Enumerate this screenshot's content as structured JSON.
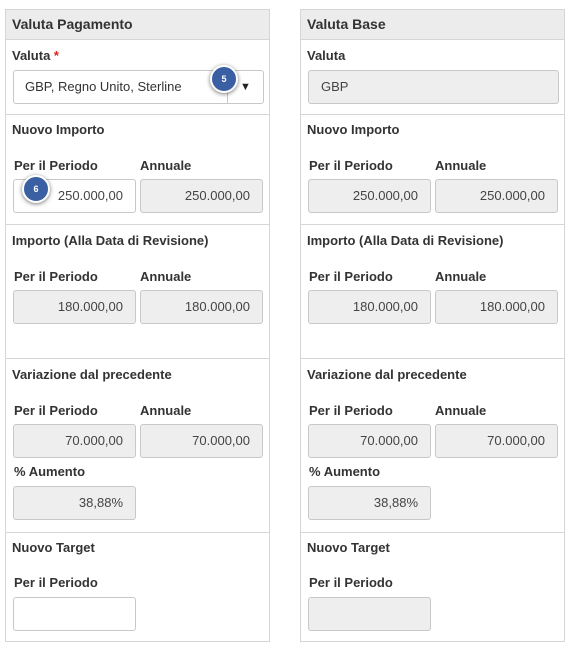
{
  "left": {
    "header": "Valuta Pagamento",
    "currency_label": "Valuta",
    "required_mark": "*",
    "currency_value": "GBP, Regno Unito, Sterline",
    "nuovo_importo": {
      "label": "Nuovo Importo",
      "periodo_label": "Per il Periodo",
      "annuale_label": "Annuale",
      "periodo_value": "250.000,00",
      "annuale_value": "250.000,00"
    },
    "importo_revisione": {
      "label": "Importo (Alla Data di Revisione)",
      "periodo_label": "Per il Periodo",
      "annuale_label": "Annuale",
      "periodo_value": "180.000,00",
      "annuale_value": "180.000,00"
    },
    "variazione": {
      "label": "Variazione dal precedente",
      "periodo_label": "Per il Periodo",
      "annuale_label": "Annuale",
      "periodo_value": "70.000,00",
      "annuale_value": "70.000,00",
      "aumento_label": "% Aumento",
      "aumento_value": "38,88%"
    },
    "nuovo_target": {
      "label": "Nuovo Target",
      "periodo_label": "Per il Periodo",
      "periodo_value": ""
    }
  },
  "right": {
    "header": "Valuta Base",
    "currency_label": "Valuta",
    "currency_value": "GBP",
    "nuovo_importo": {
      "label": "Nuovo Importo",
      "periodo_label": "Per il Periodo",
      "annuale_label": "Annuale",
      "periodo_value": "250.000,00",
      "annuale_value": "250.000,00"
    },
    "importo_revisione": {
      "label": "Importo (Alla Data di Revisione)",
      "periodo_label": "Per il Periodo",
      "annuale_label": "Annuale",
      "periodo_value": "180.000,00",
      "annuale_value": "180.000,00"
    },
    "variazione": {
      "label": "Variazione dal precedente",
      "periodo_label": "Per il Periodo",
      "annuale_label": "Annuale",
      "periodo_value": "70.000,00",
      "annuale_value": "70.000,00",
      "aumento_label": "% Aumento",
      "aumento_value": "38,88%"
    },
    "nuovo_target": {
      "label": "Nuovo Target",
      "periodo_label": "Per il Periodo",
      "periodo_value": ""
    }
  },
  "badges": {
    "step5": "5",
    "step6": "6"
  },
  "icons": {
    "dropdown": "▼"
  },
  "colors": {
    "required": "#d9251d",
    "badge": "#3a5fa3",
    "readonly_bg": "#eeeeee",
    "header_bg": "#ececec"
  }
}
